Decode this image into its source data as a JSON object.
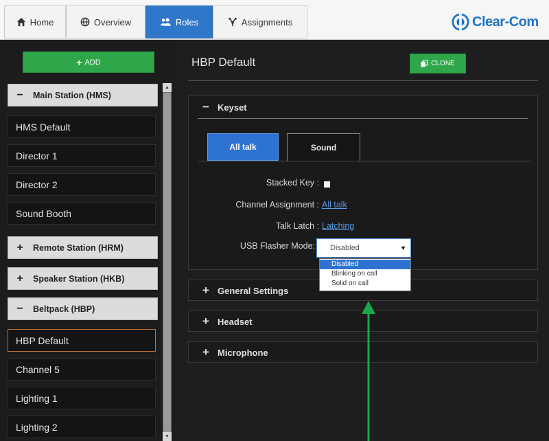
{
  "nav": {
    "tabs": [
      {
        "label": "Home",
        "icon": "home-icon"
      },
      {
        "label": "Overview",
        "icon": "globe-icon"
      },
      {
        "label": "Roles",
        "icon": "users-icon"
      },
      {
        "label": "Assignments",
        "icon": "assignments-icon"
      }
    ],
    "active_tab": "Roles",
    "logo_text": "Clear-Com"
  },
  "sidebar": {
    "add_label": "ADD",
    "groups": [
      {
        "label": "Main Station (HMS)",
        "sign": "−"
      },
      {
        "label": "Remote Station (HRM)",
        "sign": "+"
      },
      {
        "label": "Speaker Station (HKB)",
        "sign": "+"
      },
      {
        "label": "Beltpack (HBP)",
        "sign": "−"
      }
    ],
    "hms_items": [
      "HMS Default",
      "Director 1",
      "Director 2",
      "Sound Booth"
    ],
    "hbp_items": [
      "HBP Default",
      "Channel 5",
      "Lighting 1",
      "Lighting 2"
    ],
    "selected_item": "HBP Default"
  },
  "main": {
    "title": "HBP Default",
    "clone_label": "CLONE",
    "keyset": {
      "header": "Keyset",
      "sign": "−",
      "tabs": [
        "All talk",
        "Sound"
      ],
      "active_tab": "All talk",
      "stacked_key_label": "Stacked Key :",
      "stacked_key_checked": false,
      "channel_assignment_label": "Channel Assignment :",
      "channel_assignment_value": "All talk",
      "talk_latch_label": "Talk Latch :",
      "talk_latch_value": "Latching",
      "usb_flasher_label": "USB Flasher Mode:",
      "usb_flasher_value": "Disabled",
      "usb_flasher_options": [
        "Disabled",
        "Blinking on call",
        "Solid on call"
      ]
    },
    "sections": [
      {
        "label": "General Settings",
        "sign": "+"
      },
      {
        "label": "Headset",
        "sign": "+"
      },
      {
        "label": "Microphone",
        "sign": "+"
      }
    ]
  },
  "colors": {
    "accent_blue": "#2f73d2",
    "add_green": "#2fa64a",
    "link_blue": "#5b9ae6",
    "selection_orange": "#c7742c",
    "annotation_arrow": "#1aa64b"
  }
}
